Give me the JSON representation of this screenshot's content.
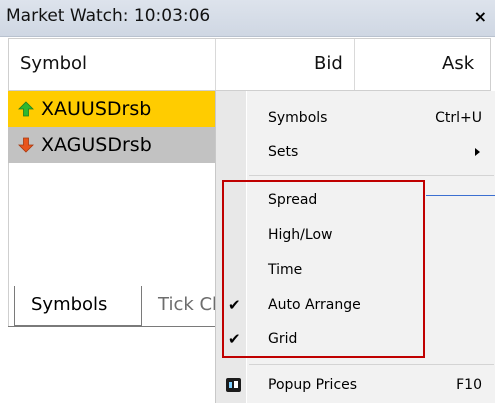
{
  "window": {
    "title": "Market Watch: 10:03:06",
    "close_label": "×"
  },
  "columns": {
    "symbol": "Symbol",
    "bid": "Bid",
    "ask": "Ask"
  },
  "symbols": [
    {
      "name": "XAUUSDrsb",
      "direction": "up",
      "row_color": "#ffcc00"
    },
    {
      "name": "XAGUSDrsb",
      "direction": "down",
      "row_color": "#c2c2c2"
    }
  ],
  "tabs": {
    "active": "Symbols",
    "inactive": "Tick Chart"
  },
  "context_menu": {
    "items": [
      {
        "label": "Symbols",
        "shortcut": "Ctrl+U"
      },
      {
        "label": "Sets",
        "has_submenu": true
      },
      {
        "label": "Spread",
        "checked": false
      },
      {
        "label": "High/Low",
        "checked": false
      },
      {
        "label": "Time",
        "checked": false
      },
      {
        "label": "Auto Arrange",
        "checked": true
      },
      {
        "label": "Grid",
        "checked": true
      },
      {
        "label": "Popup Prices",
        "shortcut": "F10",
        "icon": "popup-prices-icon"
      }
    ],
    "check_glyph": "✔"
  },
  "colors": {
    "highlight_box": "#c00000",
    "up_arrow": "#2fb82f",
    "down_arrow": "#e8541c",
    "selected_row": "#ffcc00"
  }
}
